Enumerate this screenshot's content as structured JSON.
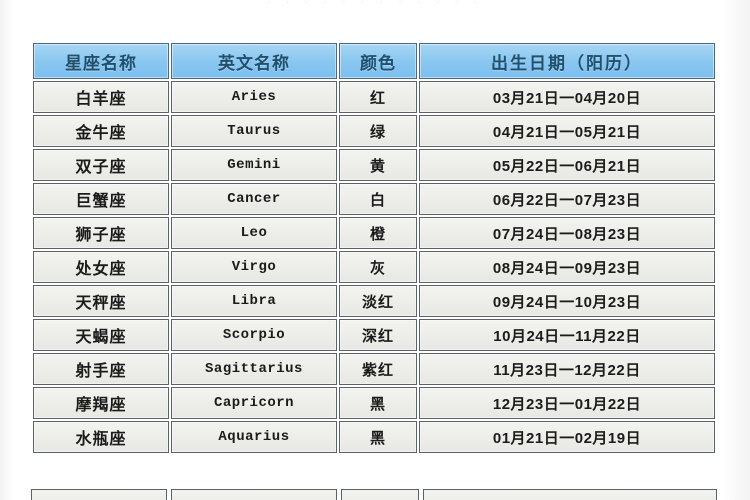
{
  "page": {
    "top_clipped_caption": "· · · · ·      · ·      · · · · ·"
  },
  "table": {
    "caption_header_color": "#8cc8f0",
    "header_text_color": "#21506e",
    "row_background": "#ecece8",
    "border_color": "#5c6168",
    "columns": [
      {
        "key": "name",
        "label": "星座名称"
      },
      {
        "key": "en",
        "label": "英文名称"
      },
      {
        "key": "color",
        "label": "颜色"
      },
      {
        "key": "date",
        "label": "出生日期（阳历）"
      }
    ],
    "rows": [
      {
        "name": "白羊座",
        "en": "Aries",
        "color": "红",
        "date": "03月21日一04月20日"
      },
      {
        "name": "金牛座",
        "en": "Taurus",
        "color": "绿",
        "date": "04月21日一05月21日"
      },
      {
        "name": "双子座",
        "en": "Gemini",
        "color": "黄",
        "date": "05月22日一06月21日"
      },
      {
        "name": "巨蟹座",
        "en": "Cancer",
        "color": "白",
        "date": "06月22日一07月23日"
      },
      {
        "name": "狮子座",
        "en": "Leo",
        "color": "橙",
        "date": "07月24日一08月23日"
      },
      {
        "name": "处女座",
        "en": "Virgo",
        "color": "灰",
        "date": "08月24日一09月23日"
      },
      {
        "name": "天秤座",
        "en": "Libra",
        "color": "淡红",
        "date": "09月24日一10月23日"
      },
      {
        "name": "天蝎座",
        "en": "Scorpio",
        "color": "深红",
        "date": "10月24日一11月22日"
      },
      {
        "name": "射手座",
        "en": "Sagittarius",
        "color": "紫红",
        "date": "11月23日一12月22日"
      },
      {
        "name": "摩羯座",
        "en": "Capricorn",
        "color": "黑",
        "date": "12月23日一01月22日"
      },
      {
        "name": "水瓶座",
        "en": "Aquarius",
        "color": "黑",
        "date": "01月21日一02月19日"
      }
    ]
  }
}
